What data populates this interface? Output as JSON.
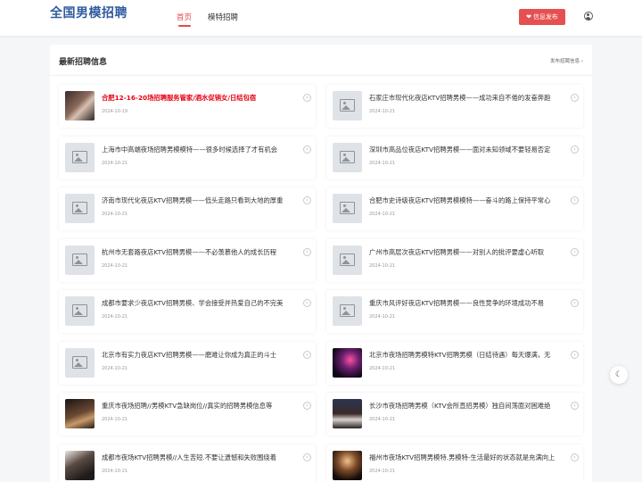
{
  "site": {
    "logo": "全国男模招聘"
  },
  "nav": [
    {
      "label": "首页"
    },
    {
      "label": "模特招聘"
    }
  ],
  "header": {
    "publish_label": "信息发布",
    "publish_icon": "heart-icon"
  },
  "panel": {
    "title": "最新招聘信息",
    "more_label": "发布招聘信息 ›"
  },
  "listings": [
    {
      "title": "合肥12-16-20场招聘服务管家/酒水促销女/日结包宿",
      "date": "2024-10-19",
      "hot": true,
      "thumb": "photo"
    },
    {
      "title": "石家庄市现代化夜店KTV招聘男模——成功来自不倦的发奋奔跑",
      "date": "2024-10-21",
      "hot": false,
      "thumb": "placeholder"
    },
    {
      "title": "上海市中高端夜场招聘男模模特——很多时候选择了才有机会",
      "date": "2024-10-21",
      "hot": false,
      "thumb": "placeholder"
    },
    {
      "title": "深圳市高品位夜店KTV招聘男模——面对未知领域不要轻易否定",
      "date": "2024-10-21",
      "hot": false,
      "thumb": "placeholder"
    },
    {
      "title": "济南市现代化夜店KTV招聘男模——低头走路只看到大地的厚重",
      "date": "2024-10-21",
      "hot": false,
      "thumb": "placeholder"
    },
    {
      "title": "合肥市史诗级夜店KTV招聘男模模特——奋斗的路上保持平常心",
      "date": "2024-10-21",
      "hot": false,
      "thumb": "placeholder"
    },
    {
      "title": "杭州市无套路夜店KTV招聘男模——不必羡慕他人的成长历程",
      "date": "2024-10-21",
      "hot": false,
      "thumb": "placeholder"
    },
    {
      "title": "广州市高层次夜店KTV招聘男模——对别人的批评要虚心听取",
      "date": "2024-10-21",
      "hot": false,
      "thumb": "placeholder"
    },
    {
      "title": "成都市要求少夜店KTV招聘男模、学会接受并热爱自己的不完美",
      "date": "2024-10-21",
      "hot": false,
      "thumb": "placeholder"
    },
    {
      "title": "重庆市风评好夜店KTV招聘男模——良性竞争的环境成功不易",
      "date": "2024-10-21",
      "hot": false,
      "thumb": "placeholder"
    },
    {
      "title": "北京市有实力夜店KTV招聘男模——磨难让你成为真正的斗士",
      "date": "2024-10-21",
      "hot": false,
      "thumb": "placeholder"
    },
    {
      "title": "北京市夜场招聘男模特KTV招聘男模（日结待遇）每天爆满，无",
      "date": "2024-10-21",
      "hot": false,
      "thumb": "photo"
    },
    {
      "title": "重庆市夜场招聘//男模KTV急缺岗位//真实的招聘男模信息等",
      "date": "2024-10-21",
      "hot": false,
      "thumb": "photo"
    },
    {
      "title": "长沙市夜场招聘男模（KTV会所直招男模）独自间荡面对困难绝",
      "date": "2024-10-21",
      "hot": false,
      "thumb": "photo"
    },
    {
      "title": "成都市夜场KTV招聘男模//人生苦短.不要让遗憾和失败围绕着",
      "date": "2024-10-21",
      "hot": false,
      "thumb": "photo"
    },
    {
      "title": "福州市夜场KTV招聘男模特.男模特-生活最好的状态就是充满向上",
      "date": "2024-10-21",
      "hot": false,
      "thumb": "photo"
    }
  ],
  "theme_toggle": {
    "icon": "moon-icon"
  },
  "colors": {
    "accent": "#e24a4a",
    "logo": "#2f5b9f",
    "hot_title": "#e60012"
  }
}
